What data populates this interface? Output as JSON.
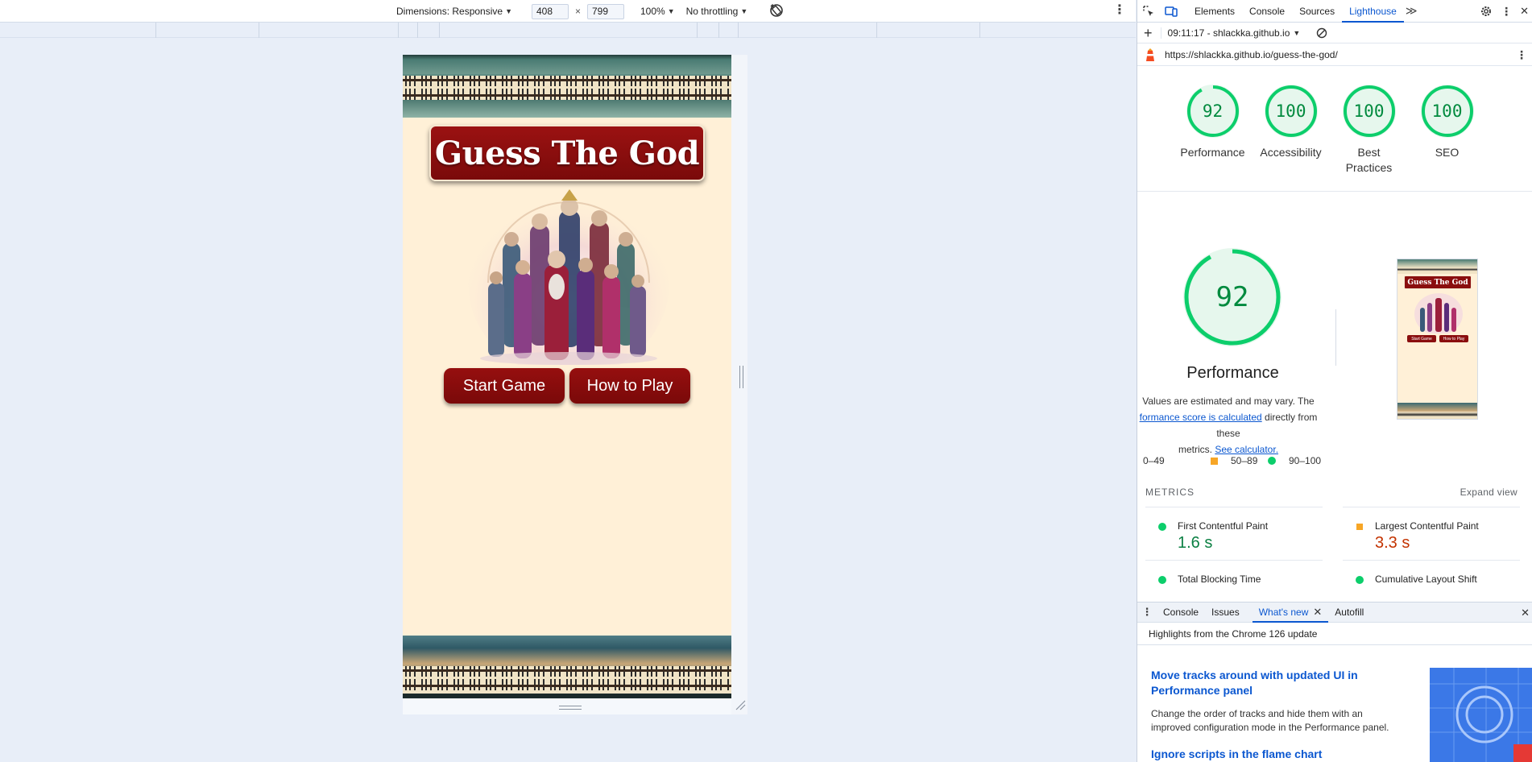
{
  "device_toolbar": {
    "dimensions_label": "Dimensions: Responsive",
    "width_value": "408",
    "times": "×",
    "height_value": "799",
    "zoom": "100%",
    "throttling": "No throttling"
  },
  "app": {
    "title": "Guess The God",
    "start_button": "Start Game",
    "howto_button": "How to Play"
  },
  "devtools": {
    "tabs": [
      "Elements",
      "Console",
      "Sources",
      "Lighthouse"
    ],
    "active_tab": "Lighthouse",
    "more_tabs": "≫",
    "report_select": "09:11:17 - shlackka.github.io",
    "url": "https://shlackka.github.io/guess-the-god/",
    "scores": [
      {
        "label": "Performance",
        "value": "92"
      },
      {
        "label": "Accessibility",
        "value": "100"
      },
      {
        "label": "Best Practices",
        "value": "100"
      },
      {
        "label": "SEO",
        "value": "100"
      }
    ],
    "main_score": {
      "value": "92",
      "label": "Performance"
    },
    "note_line1": "Values are estimated and may vary. The",
    "note_link1": "formance score is calculated",
    "note_line2_tail": " directly from these",
    "note_line3_head": "metrics. ",
    "note_link2": "See calculator.",
    "legend": {
      "fail": "0–49",
      "average": "50–89",
      "pass": "90–100"
    },
    "thumbnail": {
      "title": "Guess The God",
      "btn1": "Start Game",
      "btn2": "How to Play"
    },
    "metrics_title": "METRICS",
    "expand_view": "Expand view",
    "metrics": [
      {
        "name": "First Contentful Paint",
        "value": "1.6 s",
        "status": "good"
      },
      {
        "name": "Largest Contentful Paint",
        "value": "3.3 s",
        "status": "average"
      },
      {
        "name": "Total Blocking Time",
        "value": "",
        "status": "good"
      },
      {
        "name": "Cumulative Layout Shift",
        "value": "",
        "status": "good"
      }
    ],
    "drawer_tabs": [
      "Console",
      "Issues",
      "What's new",
      "Autofill"
    ],
    "drawer_active": "What's new",
    "whats_new_header": "Highlights from the Chrome 126 update",
    "whats_new_items": [
      {
        "title_line1": "Move tracks around with updated UI in",
        "title_line2": "Performance panel",
        "text_line1": "Change the order of tracks and hide them with an",
        "text_line2": "improved configuration mode in the Performance panel."
      },
      {
        "title_line1": "Ignore scripts in the flame chart"
      }
    ]
  },
  "colors": {
    "score_good": "#0cce6b",
    "score_text": "#008a3e",
    "accent_blue": "#0b57d0",
    "brand_red": "#8a0e0e",
    "average_orange": "#f7a626",
    "average_text": "#c33300"
  }
}
